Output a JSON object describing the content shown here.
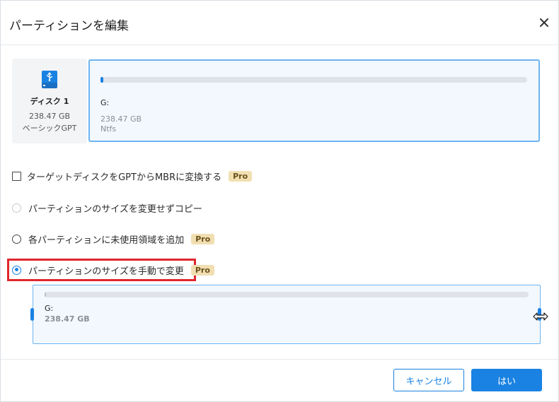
{
  "dialog": {
    "title": "パーティションを編集",
    "close_icon": "close-icon"
  },
  "disk": {
    "icon": "usb-drive-icon",
    "name": "ディスク 1",
    "size": "238.47 GB",
    "type": "ベーシックGPT"
  },
  "partition": {
    "letter": "G:",
    "size": "238.47 GB",
    "filesystem": "Ntfs"
  },
  "options": {
    "convert_gpt_mbr": {
      "label": "ターゲットディスクをGPTからMBRに変換する",
      "badge": "Pro",
      "checked": false
    },
    "copy_no_resize": {
      "label": "パーティションのサイズを変更せずコピー",
      "disabled": true
    },
    "add_unused_space": {
      "label": "各パーティションに未使用領域を追加",
      "badge": "Pro"
    },
    "manual_resize": {
      "label": "パーティションのサイズを手動で変更",
      "badge": "Pro",
      "selected": true
    }
  },
  "resize": {
    "letter": "G:",
    "size": "238.47 GB"
  },
  "footer": {
    "cancel_label": "キャンセル",
    "ok_label": "はい"
  },
  "colors": {
    "accent": "#1a82e2",
    "highlight": "#e0262e",
    "pro_badge": "#f1dfb2"
  }
}
